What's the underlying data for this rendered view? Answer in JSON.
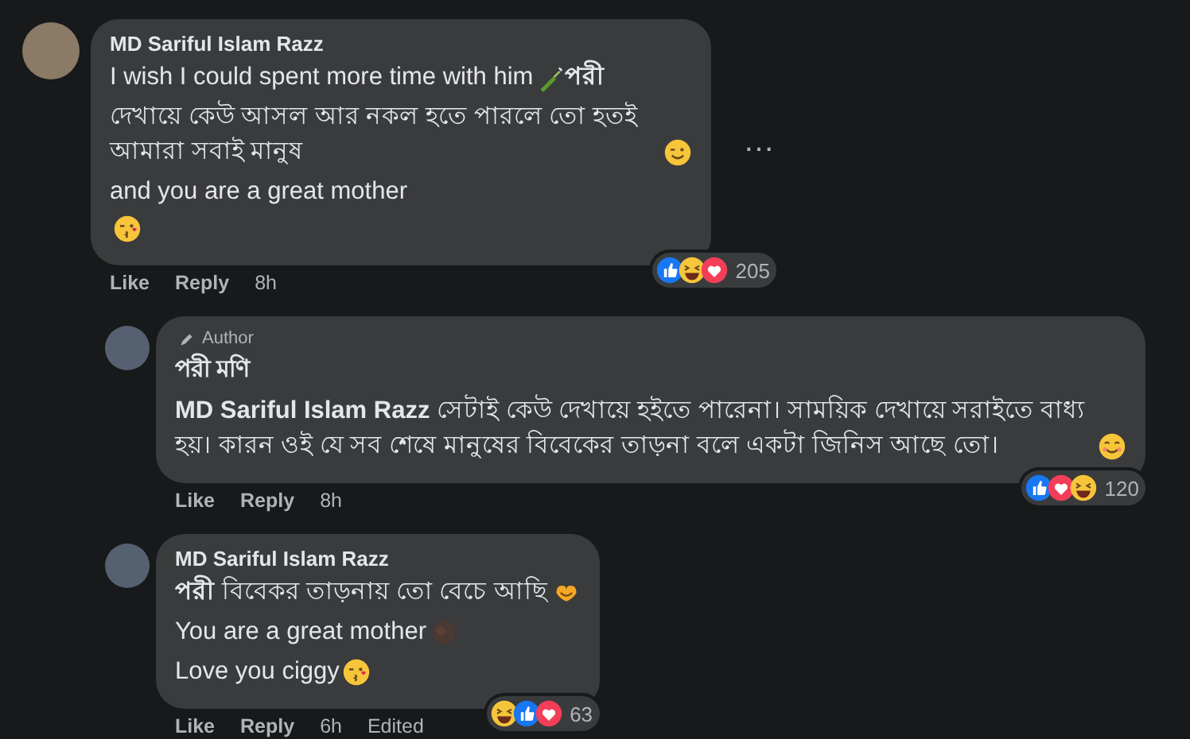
{
  "comments": [
    {
      "author": "MD Sariful Islam Razz",
      "is_author": false,
      "lines": [
        {
          "text": "I wish I could spent more time with him",
          "kind": "bottle",
          "tail": "**পরী**"
        },
        {
          "text": "দেখায়ে কেউ আসল আর নকল হতে পারলে তো হতই আমারা সবাই মানুষ",
          "kind": "wink"
        },
        {
          "text": "and you are a great mother"
        },
        {
          "kind": "kiss"
        }
      ],
      "more": "…",
      "reactions": {
        "kinds": [
          {
            "kind": "like"
          },
          {
            "kind": "haha"
          },
          {
            "kind": "love"
          }
        ],
        "count": "205"
      },
      "actions": [
        "Like",
        "Reply"
      ],
      "time": "8h",
      "children": [
        {
          "author": "পরী মণি",
          "is_author": true,
          "badge": "Author",
          "lines": [
            {
              "text": "**MD Sariful Islam Razz** সেটাই কেউ দেখায়ে হইতে পারেনা। সাময়িক দেখায়ে সরাইতে বাধ্য হয়। কারন ওই যে সব শেষে মানুষের বিবেকের তাড়না বলে একটা জিনিস আছে তো।",
              "kind": "smile"
            }
          ],
          "reactions": {
            "kinds": [
              {
                "kind": "like"
              },
              {
                "kind": "love"
              },
              {
                "kind": "haha"
              }
            ],
            "count": "120"
          },
          "actions": [
            "Like",
            "Reply"
          ],
          "time": "8h"
        },
        {
          "author": "MD Sariful Islam Razz",
          "is_author": false,
          "lines": [
            {
              "text": "**পরী** বিবেকর তাড়নায় তো বেচে আছি",
              "kind": "hearthands"
            },
            {
              "text": "You are a great mother",
              "kind": "faint"
            },
            {
              "text": "Love you ciggy",
              "kind": "kiss"
            }
          ],
          "reactions": {
            "kinds": [
              {
                "kind": "haha"
              },
              {
                "kind": "like"
              },
              {
                "kind": "love"
              }
            ],
            "count": "63"
          },
          "actions": [
            "Like",
            "Reply"
          ],
          "time": "6h",
          "edited": "Edited"
        }
      ]
    }
  ]
}
